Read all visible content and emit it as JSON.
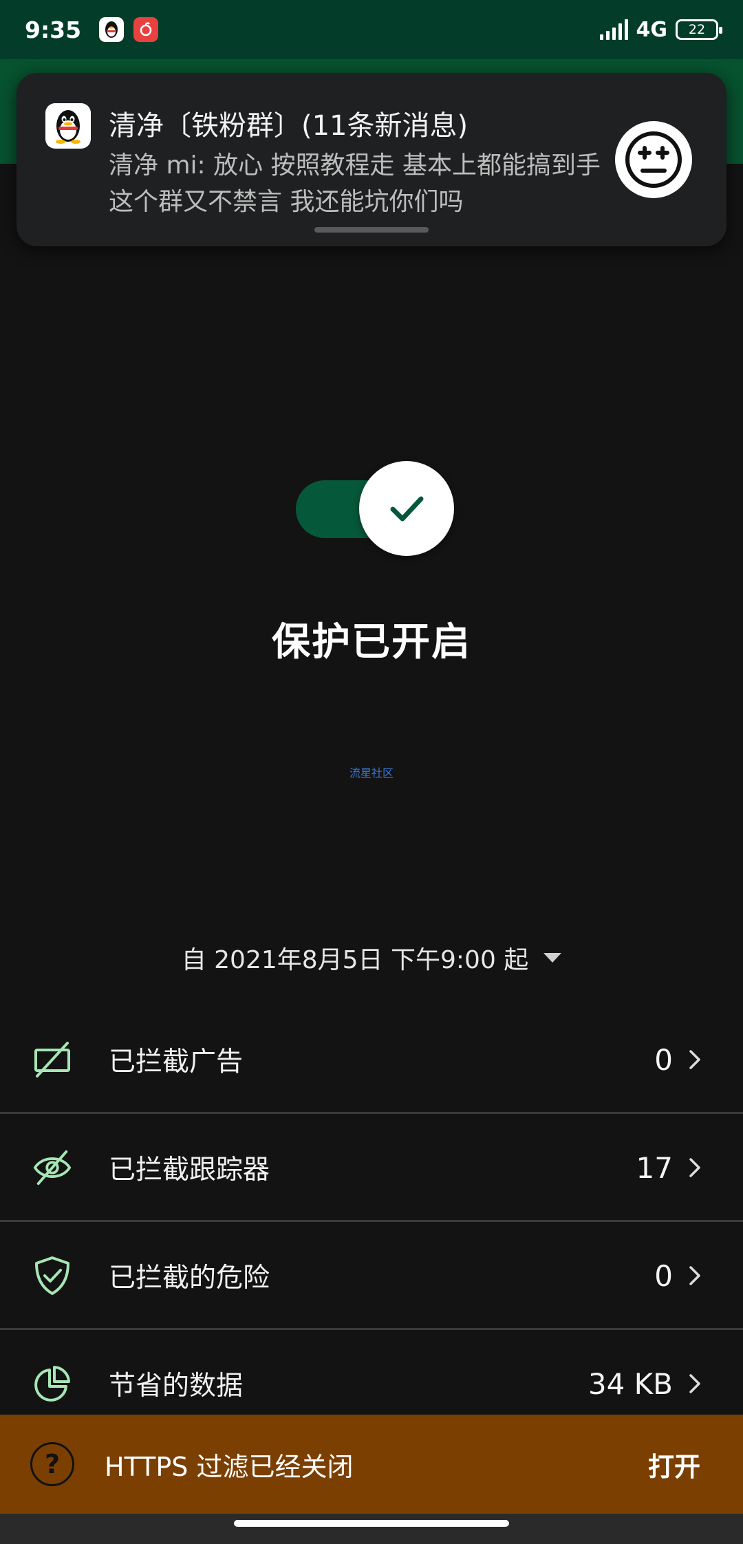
{
  "status_bar": {
    "time": "9:35",
    "network": "4G",
    "battery": "22",
    "icons": [
      "qq-icon",
      "netease-music-icon",
      "signal-icon",
      "battery-icon"
    ]
  },
  "notification": {
    "title": "清净〔铁粉群〕(11条新消息)",
    "body": "清净 mi: 放心 按照教程走 基本上都能搞到手 这个群又不禁言 我还能坑你们吗",
    "app_icon": "qq-penguin-icon",
    "avatar_icon": "face-avatar-icon"
  },
  "protection": {
    "enabled": true,
    "status_text": "保护已开启"
  },
  "watermark": "流星社区",
  "since": {
    "label": "自 2021年8月5日 下午9:00 起"
  },
  "stats": [
    {
      "label": "已拦截广告",
      "value": "0",
      "icon": "ad-blocked-icon"
    },
    {
      "label": "已拦截跟踪器",
      "value": "17",
      "icon": "eye-slash-icon"
    },
    {
      "label": "已拦截的危险",
      "value": "0",
      "icon": "shield-check-icon"
    },
    {
      "label": "节省的数据",
      "value": "34 KB",
      "icon": "pie-chart-icon"
    }
  ],
  "banner": {
    "text": "HTTPS 过滤已经关闭",
    "action": "打开",
    "icon": "help-icon"
  },
  "colors": {
    "header_green": "#033d2a",
    "accent_green": "#06583a",
    "icon_green": "#a6e6b4",
    "banner_orange": "#7b3f02"
  }
}
